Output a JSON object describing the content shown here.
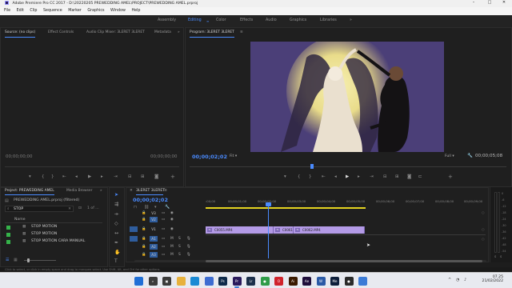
{
  "window": {
    "title": "Adobe Premiere Pro CC 2017 - D:\\20220205 PREWEDDING AMEL\\PROJECT\\PREWEDDING AMEL.prproj",
    "controls": [
      "–",
      "□",
      "✕"
    ]
  },
  "menu": [
    "File",
    "Edit",
    "Clip",
    "Sequence",
    "Marker",
    "Graphics",
    "Window",
    "Help"
  ],
  "workspaces": {
    "tabs": [
      "Assembly",
      "Editing",
      "Color",
      "Effects",
      "Audio",
      "Graphics",
      "Libraries"
    ],
    "active": "Editing",
    "more": "»"
  },
  "source_panel": {
    "tabs": [
      "Source: (no clips)",
      "Effect Controls",
      "Audio Clip Mixer: 3LERET 3LERET",
      "Metadata"
    ],
    "more": "»",
    "timecode_left": "00;00;00;00",
    "timecode_right": "00;00;00;00"
  },
  "program_panel": {
    "title": "Program: 3LERET 3LERET",
    "menu_icon": "≡",
    "timecode": "00;00;02;02",
    "zoom": "Fit",
    "quality": "Full",
    "duration": "00;00;05;08"
  },
  "project_panel": {
    "tabs": [
      "Project: PREWEDDING AMEL",
      "Media Browser"
    ],
    "more": "»",
    "project_file": "PREWEDDING AMEL.prproj (filtered)",
    "search_value": "STOP",
    "count": "1 of ...",
    "column_header": "Name",
    "items": [
      {
        "name": "STOP MOTION",
        "color": "#35b34a"
      },
      {
        "name": "STOP MOTION",
        "color": "#35b34a"
      },
      {
        "name": "STOP MOTION CARA MANUAL",
        "color": "#35b34a"
      }
    ]
  },
  "timeline": {
    "sequence_name": "3LERET 3LERET",
    "timecode": "00;00;02;02",
    "ruler": [
      ":00;00",
      "00;00;01;00",
      "00;00;02;00",
      "00;00;03;00",
      "00;00;04;00",
      "00;00;05;00",
      "00;00;06;00",
      "00;00;07;00",
      "00;00;08;00",
      "00;00;09;00"
    ],
    "video_tracks": [
      "V3",
      "V2",
      "V1"
    ],
    "audio_tracks": [
      "A1",
      "A2",
      "A3"
    ],
    "clips": [
      {
        "label": "C0055.MP4",
        "fx": "fx"
      },
      {
        "label": "C0061",
        "fx": "fx"
      },
      {
        "label": "C0062.MP4",
        "fx": "fx"
      }
    ],
    "track_toggles": [
      "M",
      "S"
    ]
  },
  "vu_meter": {
    "labels": [
      "0",
      "-6",
      "-12",
      "-18",
      "-24",
      "-30",
      "-36",
      "-42",
      "-48",
      "-54"
    ],
    "footer": [
      "S",
      "S"
    ]
  },
  "status_bar": "Click to select, or click in empty space and drag to marquee select. Use Shift, Alt, and Ctrl for other options.",
  "taskbar": {
    "icons": [
      {
        "name": "windows-start-icon",
        "color": "#1f6fd6",
        "label": ""
      },
      {
        "name": "search-icon",
        "color": "#3a3a3a",
        "label": "⌕"
      },
      {
        "name": "task-view-icon",
        "color": "#3a3a3a",
        "label": "▣"
      },
      {
        "name": "file-explorer-icon",
        "color": "#e7b13c",
        "label": ""
      },
      {
        "name": "edge-icon",
        "color": "#1a8ad4",
        "label": ""
      },
      {
        "name": "store-icon",
        "color": "#3d6cd1",
        "label": ""
      },
      {
        "name": "photoshop-icon",
        "color": "#0e2a4a",
        "label": "Ps"
      },
      {
        "name": "premiere-icon",
        "color": "#2a1a5c",
        "label": "Pr"
      },
      {
        "name": "lightroom-icon",
        "color": "#1b2f4a",
        "label": "Lr"
      },
      {
        "name": "chrome-icon",
        "color": "#2f9c48",
        "label": "●"
      },
      {
        "name": "opera-icon",
        "color": "#d0242c",
        "label": "O"
      },
      {
        "name": "illustrator-icon",
        "color": "#3a1a00",
        "label": "Ai"
      },
      {
        "name": "after-effects-icon",
        "color": "#1e0d3a",
        "label": "Ae"
      },
      {
        "name": "word-icon",
        "color": "#2b5aa6",
        "label": "W"
      },
      {
        "name": "media-encoder-icon",
        "color": "#0d1e3a",
        "label": "Me"
      },
      {
        "name": "obs-icon",
        "color": "#2a2a2a",
        "label": "●"
      },
      {
        "name": "app-icon",
        "color": "#3c7bd6",
        "label": ""
      }
    ],
    "tray": "^",
    "time": "07.25",
    "date": "21/02/2022"
  }
}
